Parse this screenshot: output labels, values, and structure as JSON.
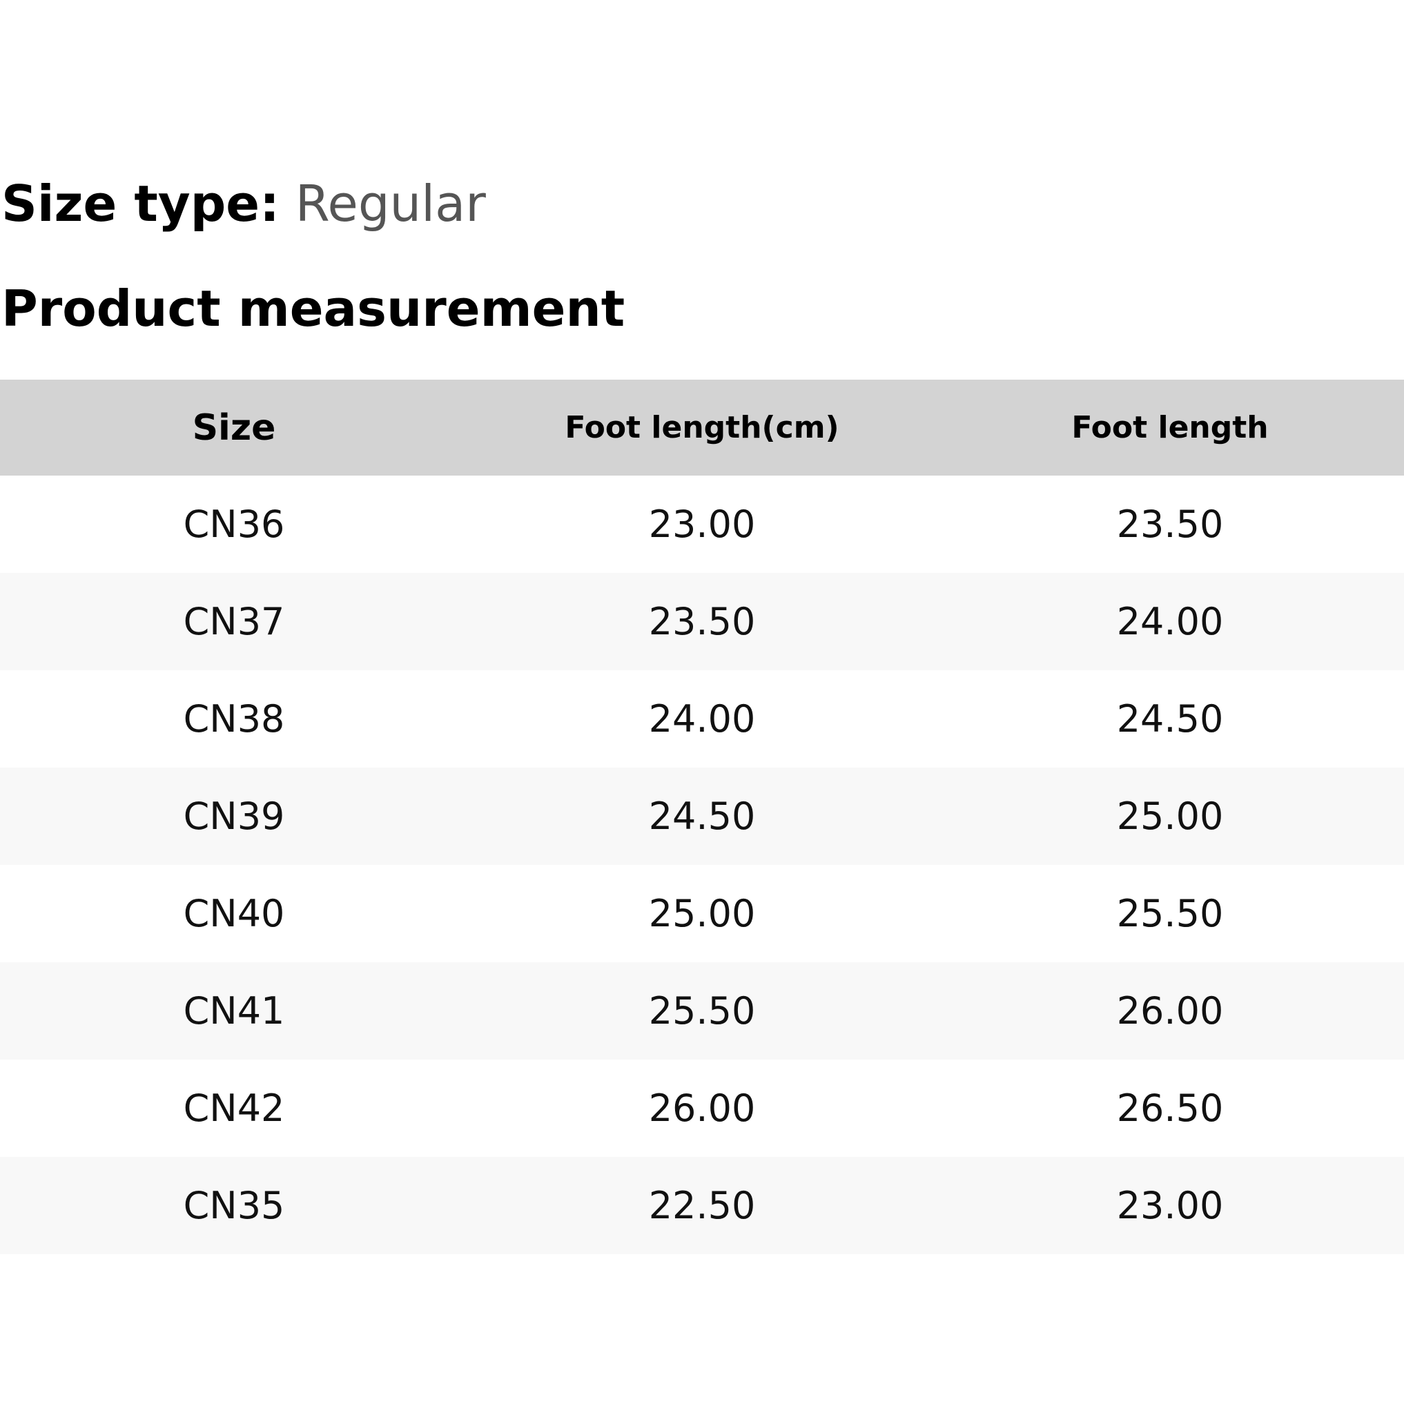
{
  "size_type": {
    "label": "Size type:",
    "value": "Regular"
  },
  "section_title": "Product measurement",
  "table": {
    "headers": [
      "Size",
      "Foot length(cm)",
      "Foot length"
    ],
    "rows": [
      [
        "CN36",
        "23.00",
        "23.50"
      ],
      [
        "CN37",
        "23.50",
        "24.00"
      ],
      [
        "CN38",
        "24.00",
        "24.50"
      ],
      [
        "CN39",
        "24.50",
        "25.00"
      ],
      [
        "CN40",
        "25.00",
        "25.50"
      ],
      [
        "CN41",
        "25.50",
        "26.00"
      ],
      [
        "CN42",
        "26.00",
        "26.50"
      ],
      [
        "CN35",
        "22.50",
        "23.00"
      ]
    ]
  },
  "colors": {
    "header_background": "#d3d3d3",
    "striped_row_background": "#f8f8f8",
    "size_type_value": "#555555"
  }
}
